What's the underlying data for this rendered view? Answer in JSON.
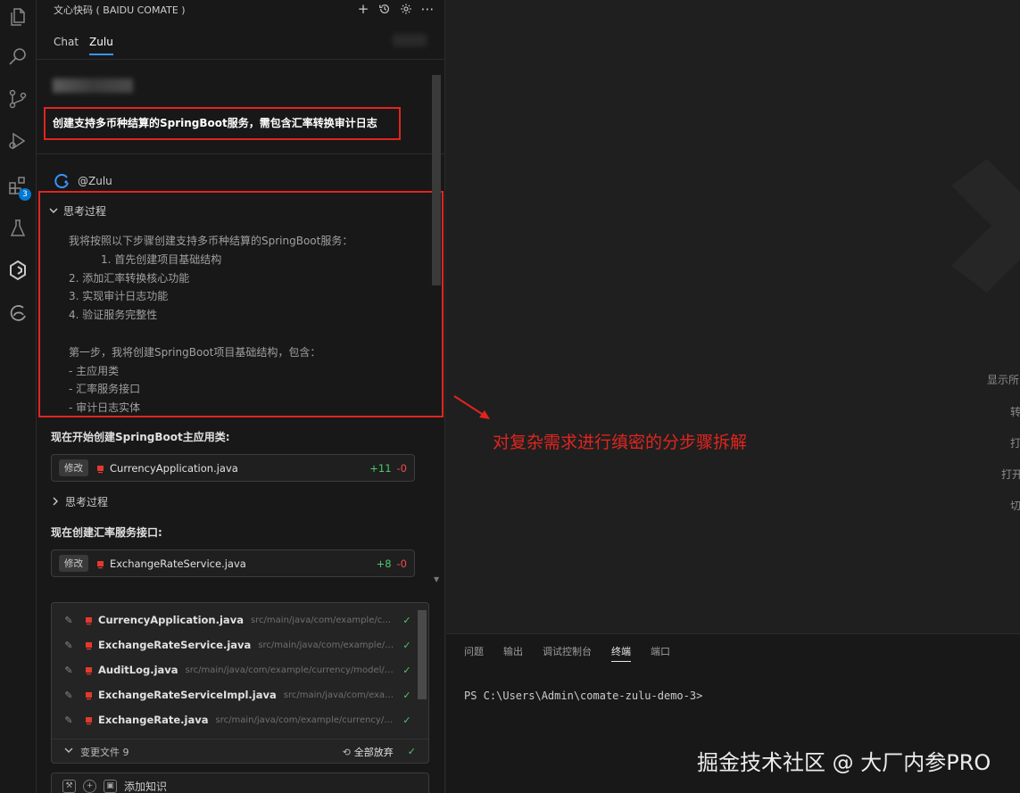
{
  "activity_bar": {
    "items": [
      {
        "name": "explorer",
        "icon": "files-icon"
      },
      {
        "name": "search",
        "icon": "search-icon"
      },
      {
        "name": "source-control",
        "icon": "source-control-icon"
      },
      {
        "name": "run-debug",
        "icon": "run-debug-icon"
      },
      {
        "name": "extensions",
        "icon": "extensions-icon",
        "badge": "3"
      },
      {
        "name": "testing",
        "icon": "flask-icon"
      },
      {
        "name": "comate",
        "icon": "comate-icon"
      },
      {
        "name": "edge",
        "icon": "edge-icon"
      }
    ]
  },
  "panel": {
    "title": "文心快码 ( BAIDU COMATE )",
    "tabs": [
      {
        "label": "Chat",
        "active": false
      },
      {
        "label": "Zulu",
        "active": true
      }
    ],
    "user_message": "创建支持多币种结算的SpringBoot服务，需包含汇率转换审计日志",
    "agent_name": "@Zulu",
    "thinking": {
      "title": "思考过程",
      "lines": [
        "我将按照以下步骤创建支持多币种结算的SpringBoot服务：",
        "1. 首先创建项目基础结构",
        "2. 添加汇率转换核心功能",
        "3. 实现审计日志功能",
        "4. 验证服务完整性",
        "",
        "第一步，我将创建SpringBoot项目基础结构，包含：",
        "- 主应用类",
        "- 汇率服务接口",
        "- 审计日志实体"
      ]
    },
    "step1": {
      "text": "现在开始创建SpringBoot主应用类:",
      "tag": "修改",
      "file": "CurrencyApplication.java",
      "added": "+11",
      "removed": "-0"
    },
    "thinking2_title": "思考过程",
    "step2": {
      "text": "现在创建汇率服务接口:",
      "tag": "修改",
      "file": "ExchangeRateService.java",
      "added": "+8",
      "removed": "-0"
    },
    "changes": {
      "files": [
        {
          "name": "CurrencyApplication.java",
          "path": "src/main/java/com/example/curren..."
        },
        {
          "name": "ExchangeRateService.java",
          "path": "src/main/java/com/example/curre..."
        },
        {
          "name": "AuditLog.java",
          "path": "src/main/java/com/example/currency/model/A..."
        },
        {
          "name": "ExchangeRateServiceImpl.java",
          "path": "src/main/java/com/example/..."
        },
        {
          "name": "ExchangeRate.java",
          "path": "src/main/java/com/example/currency/mo..."
        }
      ],
      "footer_label": "变更文件 9",
      "discard_all": "全部放弃"
    },
    "input_placeholder": "添加知识"
  },
  "editor": {
    "side_texts": [
      "显示所",
      "转",
      "打",
      "打开",
      "切"
    ],
    "annotation": "对复杂需求进行缜密的分步骤拆解"
  },
  "terminal": {
    "tabs": [
      {
        "label": "问题",
        "active": false
      },
      {
        "label": "输出",
        "active": false
      },
      {
        "label": "调试控制台",
        "active": false
      },
      {
        "label": "终端",
        "active": true
      },
      {
        "label": "端口",
        "active": false
      }
    ],
    "prompt": "PS C:\\Users\\Admin\\comate-zulu-demo-3>",
    "watermark": "掘金技术社区 @ 大厂内参PRO"
  },
  "colors": {
    "accent": "#3794ff",
    "highlight_red": "#e0251f",
    "added_green": "#4ec96e",
    "removed_red": "#f14c4c"
  }
}
